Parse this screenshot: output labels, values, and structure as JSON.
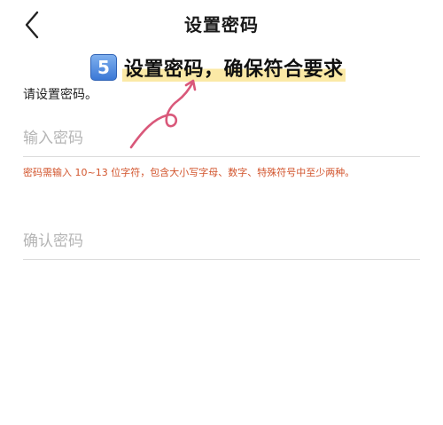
{
  "header": {
    "title": "设置密码",
    "back_icon": "chevron-left-icon"
  },
  "annotation": {
    "step_number": "5",
    "text": "设置密码，确保符合要求",
    "highlight_color": "#fbe9a6",
    "arrow_color": "#d9587a"
  },
  "form": {
    "prompt": "请设置密码。",
    "password_placeholder": "输入密码",
    "hint": "密码需输入 10~13 位字符，包含大小写字母、数字、特殊符号中至少两种。",
    "confirm_placeholder": "确认密码",
    "hint_color": "#d2542c"
  }
}
